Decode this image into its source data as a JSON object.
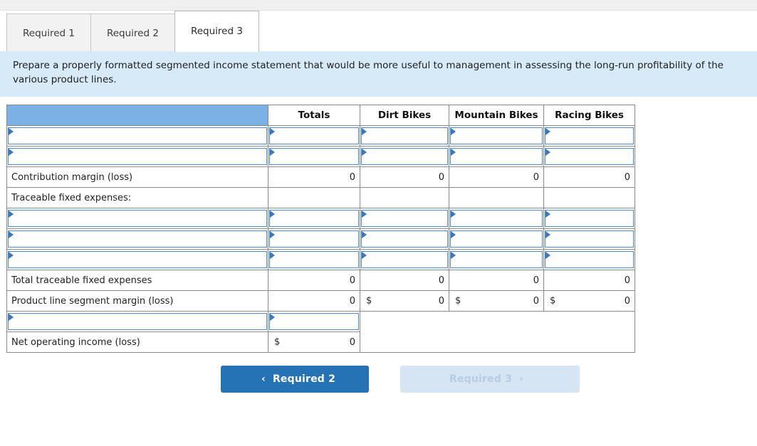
{
  "tabs": [
    {
      "label": "Required 1",
      "active": false
    },
    {
      "label": "Required 2",
      "active": false
    },
    {
      "label": "Required 3",
      "active": true
    }
  ],
  "instructions": {
    "text": "Prepare a properly formatted segmented income statement that would be more useful to management in assessing the long-run profitability of the various product lines."
  },
  "table": {
    "headers": [
      "",
      "Totals",
      "Dirt Bikes",
      "Mountain Bikes",
      "Racing Bikes"
    ],
    "rows": [
      {
        "type": "entry-all",
        "label": "",
        "totals": "",
        "dirt": "",
        "mountain": "",
        "racing": ""
      },
      {
        "type": "entry-all",
        "label": "",
        "totals": "",
        "dirt": "",
        "mountain": "",
        "racing": ""
      },
      {
        "type": "value",
        "label": "Contribution margin (loss)",
        "totals": "0",
        "dirt": "0",
        "mountain": "0",
        "racing": "0"
      },
      {
        "type": "header-text",
        "label": "Traceable fixed expenses:",
        "totals": "",
        "dirt": "",
        "mountain": "",
        "racing": ""
      },
      {
        "type": "entry-all",
        "label": "",
        "totals": "",
        "dirt": "",
        "mountain": "",
        "racing": ""
      },
      {
        "type": "entry-all",
        "label": "",
        "totals": "",
        "dirt": "",
        "mountain": "",
        "racing": ""
      },
      {
        "type": "entry-all",
        "label": "",
        "totals": "",
        "dirt": "",
        "mountain": "",
        "racing": ""
      },
      {
        "type": "value",
        "label": "Total traceable fixed expenses",
        "totals": "0",
        "dirt": "0",
        "mountain": "0",
        "racing": "0"
      },
      {
        "type": "currency",
        "label": "Product line segment margin (loss)",
        "totals": "0",
        "dirt": "0",
        "mountain": "0",
        "racing": "0",
        "currency_symbol": "$"
      },
      {
        "type": "entry-two",
        "label": "",
        "totals": ""
      },
      {
        "type": "currency-two",
        "label": "Net operating income (loss)",
        "totals": "0",
        "currency_symbol": "$"
      }
    ]
  },
  "nav": {
    "prev_label": "Required 2",
    "prev_icon": "chevron-left-icon",
    "prev_chevron": "‹",
    "next_label": "Required 3",
    "next_icon": "chevron-right-icon",
    "next_chevron": "›",
    "next_disabled": true
  },
  "colors": {
    "header_blue": "#7cb1e6",
    "banner_blue": "#d6eaf8",
    "button_blue": "#2572b4",
    "button_disabled": "#d6e5f3",
    "entry_border": "#4f88c8"
  }
}
